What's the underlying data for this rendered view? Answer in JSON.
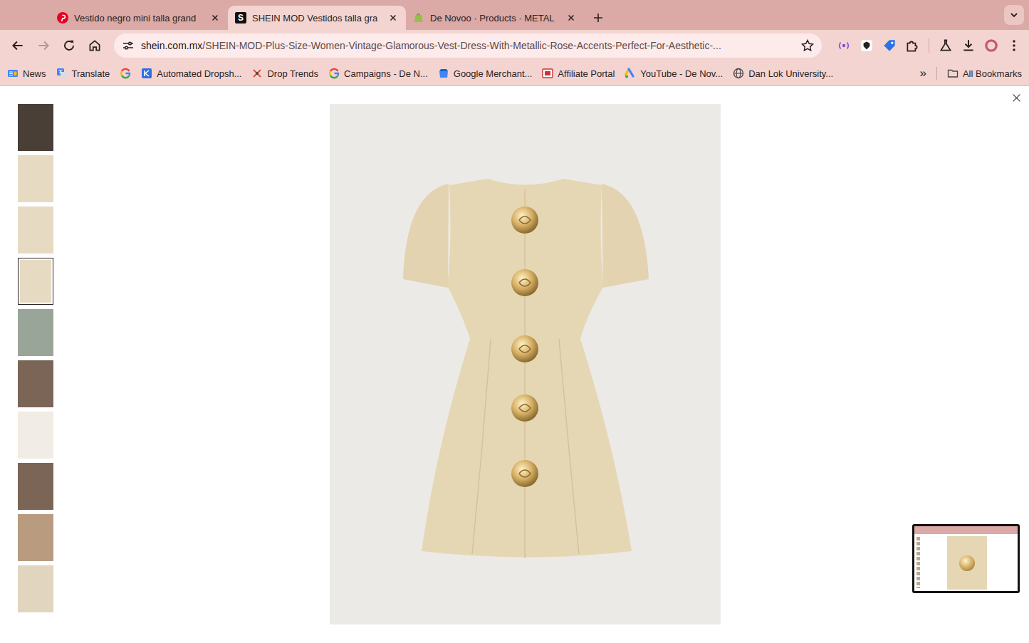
{
  "browser": {
    "tabs": [
      {
        "label": "Vestido negro mini talla grand",
        "selected": false,
        "kind": "pinterest"
      },
      {
        "label": "SHEIN MOD Vestidos talla gra",
        "selected": true,
        "kind": "shein",
        "favicon_text": "S"
      },
      {
        "label": "De Novoo · Products · METAL",
        "selected": false,
        "kind": "shopify"
      }
    ],
    "navigation": {
      "back_enabled": true,
      "forward_enabled": false
    },
    "address": {
      "host": "shein.com.mx",
      "path": "/SHEIN-MOD-Plus-Size-Women-Vintage-Glamorous-Vest-Dress-With-Metallic-Rose-Accents-Perfect-For-Aesthetic-...",
      "bookmarked": false
    },
    "bookmarks": [
      {
        "label": "News",
        "kind": "news"
      },
      {
        "label": "Translate",
        "kind": "translate"
      },
      {
        "kind": "google"
      },
      {
        "label": "Automated Dropsh...",
        "kind": "automated"
      },
      {
        "label": "Drop Trends",
        "kind": "droptrends"
      },
      {
        "label": "Campaigns - De N...",
        "kind": "google"
      },
      {
        "label": "Google Merchant...",
        "kind": "merchant"
      },
      {
        "label": "Affiliate Portal",
        "kind": "affiliate"
      },
      {
        "label": "YouTube - De Nov...",
        "kind": "ads"
      },
      {
        "label": "Dan Lok University...",
        "kind": "globe"
      }
    ],
    "bookmarks_overflow": "»",
    "all_bookmarks": "All Bookmarks"
  },
  "gallery": {
    "thumbnails": [
      {
        "selected": false
      },
      {
        "selected": false
      },
      {
        "selected": false
      },
      {
        "selected": true
      },
      {
        "selected": false
      },
      {
        "selected": false
      },
      {
        "selected": false
      },
      {
        "selected": false
      },
      {
        "selected": false
      },
      {
        "selected": false
      }
    ]
  }
}
